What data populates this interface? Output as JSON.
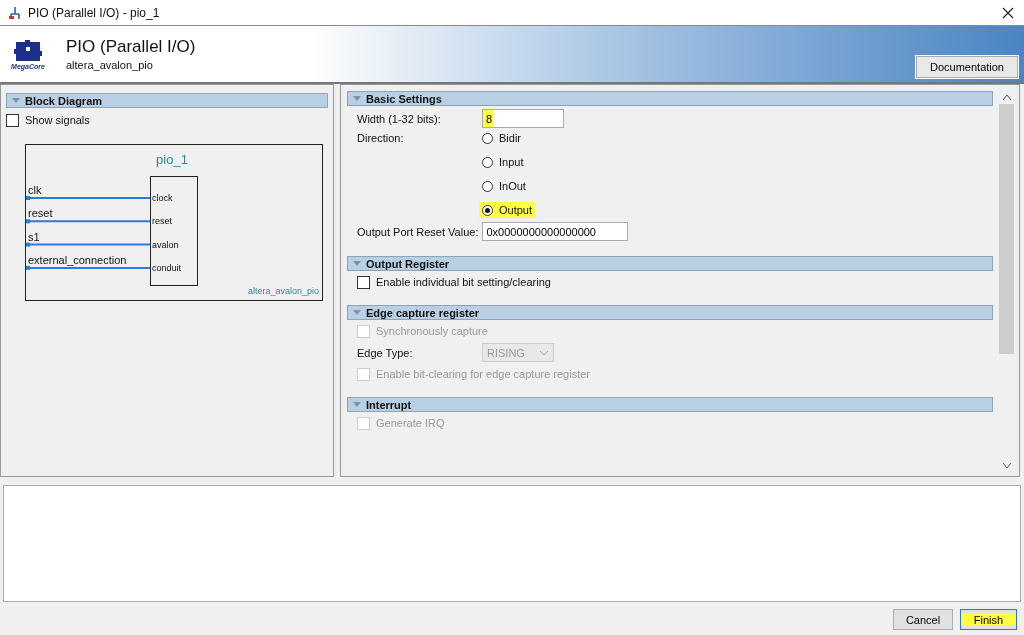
{
  "window": {
    "title": "PIO (Parallel I/O) - pio_1"
  },
  "header": {
    "title": "PIO (Parallel I/O)",
    "subtitle": "altera_avalon_pio",
    "logo_text": "MegaCore"
  },
  "documentation_button": "Documentation",
  "block_diagram": {
    "title": "Block Diagram",
    "show_signals": {
      "label": "Show signals",
      "checked": false
    },
    "instance": "pio_1",
    "component": "altera_avalon_pio",
    "ports": [
      {
        "signal": "clk",
        "interface": "clock"
      },
      {
        "signal": "reset",
        "interface": "reset"
      },
      {
        "signal": "s1",
        "interface": "avalon"
      },
      {
        "signal": "external_connection",
        "interface": "conduit"
      }
    ]
  },
  "sections": [
    {
      "title": "Basic Settings",
      "items": [
        {
          "kind": "text-field",
          "label": "Width (1-32 bits):",
          "value": "8",
          "highlighted": true
        },
        {
          "kind": "radio-group",
          "label": "Direction:",
          "options": [
            {
              "label": "Bidir",
              "selected": false,
              "highlighted": false
            },
            {
              "label": "Input",
              "selected": false,
              "highlighted": false
            },
            {
              "label": "InOut",
              "selected": false,
              "highlighted": false
            },
            {
              "label": "Output",
              "selected": true,
              "highlighted": true
            }
          ]
        },
        {
          "kind": "text-field",
          "label": "Output Port Reset Value:",
          "value": "0x0000000000000000",
          "highlighted": false
        }
      ]
    },
    {
      "title": "Output Register",
      "items": [
        {
          "kind": "checkbox",
          "label": "Enable individual bit setting/clearing",
          "checked": false,
          "disabled": false
        }
      ]
    },
    {
      "title": "Edge capture register",
      "items": [
        {
          "kind": "checkbox",
          "label": "Synchronously capture",
          "checked": false,
          "disabled": true
        },
        {
          "kind": "dropdown",
          "label": "Edge Type:",
          "value": "RISING",
          "disabled": true
        },
        {
          "kind": "checkbox",
          "label": "Enable bit-clearing for edge capture register",
          "checked": false,
          "disabled": true
        }
      ]
    },
    {
      "title": "Interrupt",
      "items": [
        {
          "kind": "checkbox",
          "label": "Generate IRQ",
          "checked": false,
          "disabled": true
        }
      ]
    }
  ],
  "buttons": [
    {
      "label": "Cancel",
      "highlighted": false
    },
    {
      "label": "Finish",
      "highlighted": true
    }
  ]
}
